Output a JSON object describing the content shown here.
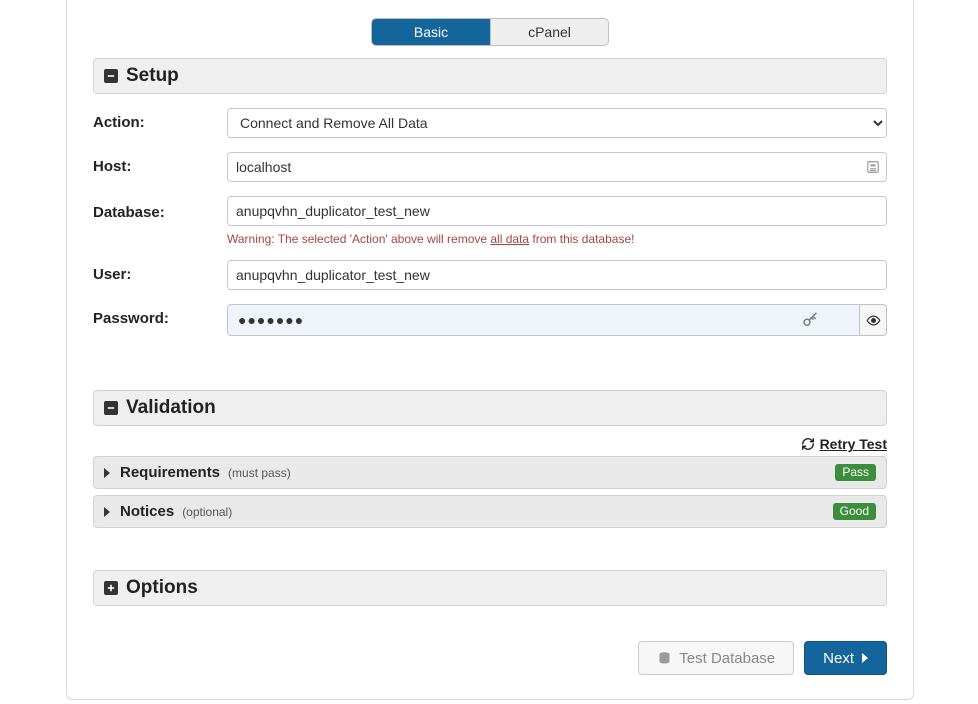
{
  "tabs": {
    "basic": "Basic",
    "cpanel": "cPanel"
  },
  "sections": {
    "setup": "Setup",
    "validation": "Validation",
    "options": "Options"
  },
  "form": {
    "action_label": "Action:",
    "action_value": "Connect and Remove All Data",
    "host_label": "Host:",
    "host_value": "localhost",
    "database_label": "Database:",
    "database_value": "anupqvhn_duplicator_test_new",
    "warning_pre": "Warning: The selected 'Action' above will remove ",
    "warning_mid": "all data",
    "warning_post": " from this database!",
    "user_label": "User:",
    "user_value": "anupqvhn_duplicator_test_new",
    "password_label": "Password:",
    "password_value": "●●●●●●●"
  },
  "validation": {
    "retry": "Retry Test",
    "req_title": "Requirements",
    "req_note": "(must pass)",
    "req_badge": "Pass",
    "notice_title": "Notices",
    "notice_note": "(optional)",
    "notice_badge": "Good"
  },
  "buttons": {
    "test": "Test Database",
    "next": "Next"
  }
}
